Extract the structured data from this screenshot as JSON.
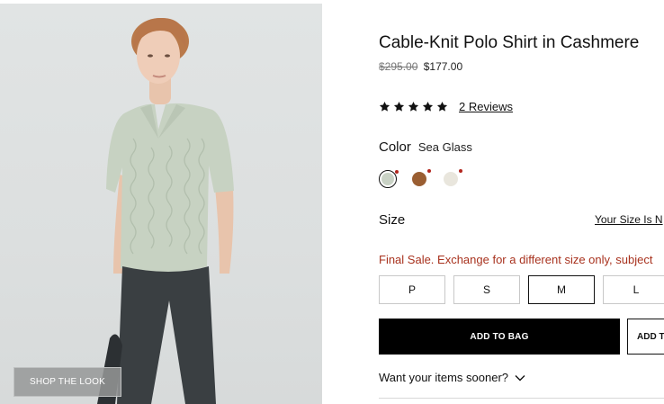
{
  "image": {
    "alt": "Model wearing a sea glass cable-knit polo sweater and dark trousers",
    "shop_the_look_label": "SHOP THE LOOK"
  },
  "product": {
    "title": "Cable-Knit Polo Shirt in Cashmere",
    "price_original": "$295.00",
    "price_sale": "$177.00",
    "rating": 5,
    "reviews_link": "2 Reviews"
  },
  "color": {
    "label": "Color",
    "selected_value": "Sea Glass",
    "swatches": [
      {
        "name": "sea-glass",
        "hex": "#c9d2c5",
        "selected": true
      },
      {
        "name": "brown",
        "hex": "#9a5e32",
        "selected": false
      },
      {
        "name": "cream",
        "hex": "#e9e6dd",
        "selected": false
      }
    ]
  },
  "size": {
    "label": "Size",
    "guide_link": "Your Size Is N",
    "final_sale_notice": "Final Sale. Exchange for a different size only, subject",
    "options": [
      {
        "label": "P",
        "selected": false
      },
      {
        "label": "S",
        "selected": false
      },
      {
        "label": "M",
        "selected": true
      },
      {
        "label": "L",
        "selected": false
      }
    ]
  },
  "actions": {
    "add_to_bag": "ADD TO BAG",
    "secondary_partial": "ADD T"
  },
  "delivery": {
    "sooner_label": "Want your items sooner?"
  },
  "colors": {
    "accent_red": "#a8321e",
    "primary_button": "#000000"
  }
}
